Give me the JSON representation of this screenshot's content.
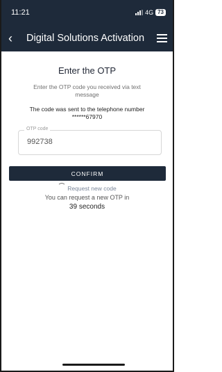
{
  "status_bar": {
    "time": "11:21",
    "network": "4G",
    "battery": "73"
  },
  "header": {
    "title": "Digital Solutions Activation",
    "back_icon": "chevron-left-icon",
    "menu_icon": "hamburger-menu-icon"
  },
  "colors": {
    "header_bg": "#1e2a3a",
    "button_bg": "#1e2a3a",
    "link": "#7a8699"
  },
  "otp": {
    "title": "Enter the OTP",
    "instruction": "Enter the OTP code you received via text message",
    "sent_line1": "The code was sent to the telephone number",
    "phone_masked": "******67970",
    "field_label": "OTP code",
    "field_value": "992738",
    "confirm_label": "CONFIRM",
    "request_label": "Request new code",
    "can_request_text": "You can request a new OTP in",
    "countdown": "39 seconds"
  }
}
